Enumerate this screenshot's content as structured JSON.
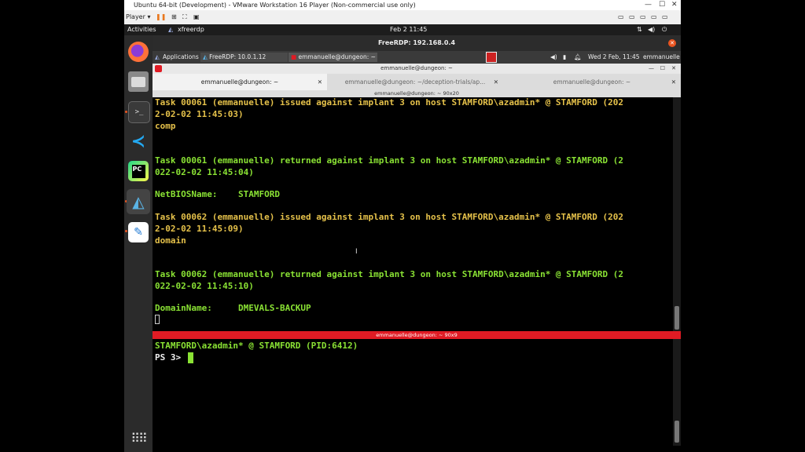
{
  "vmware": {
    "title": "Ubuntu 64-bit (Development) - VMware Workstation 16 Player (Non-commercial use only)",
    "player_label": "Player ▾"
  },
  "ubuntu_bar": {
    "activities": "Activities",
    "app_name": "xfreerdp",
    "clock": "Feb 2  11:45"
  },
  "rdp": {
    "window_title": "FreeRDP: 192.168.0.4",
    "panel": {
      "applications": "Applications",
      "task1": "FreeRDP: 10.0.1.12",
      "task2": "emmanuelle@dungeon: ~",
      "clock": "Wed  2 Feb, 11:45",
      "user": "emmanuelle"
    }
  },
  "terminal": {
    "window_title": "emmanuelle@dungeon: ~",
    "tabs": [
      {
        "label": "emmanuelle@dungeon: ~"
      },
      {
        "label": "emmanuelle@dungeon: ~/deception-trials/ap..."
      },
      {
        "label": "emmanuelle@dungeon: ~"
      }
    ],
    "pane1_title": "emmanuelle@dungeon: ~ 90x20",
    "pane1_lines": [
      {
        "text": "Task 00061 (emmanuelle) issued against implant 3 on host STAMFORD\\azadmin* @ STAMFORD (202",
        "color": "yellow"
      },
      {
        "text": "2-02-02 11:45:03)",
        "color": "yellow"
      },
      {
        "text": "comp",
        "color": "yellow"
      },
      {
        "text": "Task 00061 (emmanuelle) returned against implant 3 on host STAMFORD\\azadmin* @ STAMFORD (2",
        "color": "green"
      },
      {
        "text": "022-02-02 11:45:04)",
        "color": "green"
      },
      {
        "text": "NetBIOSName:    STAMFORD",
        "color": "green"
      },
      {
        "text": "Task 00062 (emmanuelle) issued against implant 3 on host STAMFORD\\azadmin* @ STAMFORD (202",
        "color": "yellow"
      },
      {
        "text": "2-02-02 11:45:09)",
        "color": "yellow"
      },
      {
        "text": "domain",
        "color": "yellow"
      },
      {
        "text": "Task 00062 (emmanuelle) returned against implant 3 on host STAMFORD\\azadmin* @ STAMFORD (2",
        "color": "green"
      },
      {
        "text": "022-02-02 11:45:10)",
        "color": "green"
      },
      {
        "text": "DomainName:     DMEVALS-BACKUP",
        "color": "green"
      }
    ],
    "pane2_title": "emmanuelle@dungeon: ~ 90x9",
    "pane2_lines": [
      {
        "text": "STAMFORD\\azadmin* @ STAMFORD (PID:6412)",
        "color": "green"
      },
      {
        "text": "PS 3> ",
        "color": "white"
      }
    ]
  },
  "colors": {
    "ubuntu_orange": "#e95420",
    "terminal_yellow": "#e5c14a",
    "terminal_green": "#8ae234",
    "active_pane_red": "#e01b24"
  }
}
